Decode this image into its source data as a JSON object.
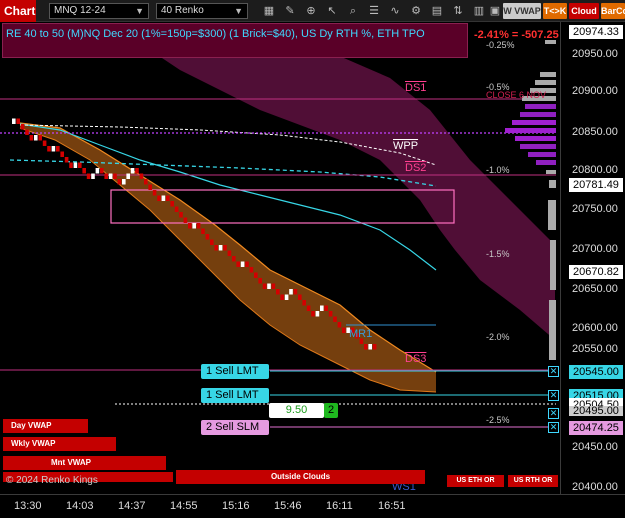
{
  "toolbar": {
    "chart_label": "Chart",
    "instrument": "MNQ 12-24",
    "bar_type": "40 Renko",
    "wvwap_label": "W VWAP",
    "tk_label": "T<>K",
    "cloud_label": "Cloud",
    "barco_label": "BarCo"
  },
  "header": {
    "info": "RE 40 to 50 (M)NQ Dec 20 (1%=150p=$300) (1 Brick=$40), US Dy RTH %, ETH TPO",
    "pct_change": "-2.41% = -507.25"
  },
  "levels": {
    "ds1": "DS1",
    "close6": "CLOSE 6 NOV",
    "wpp": "WPP",
    "ds2": "DS2",
    "mr1": "MR1",
    "ds3": "DS3",
    "ws1": "WS1"
  },
  "percent_labels": [
    "-0.25%",
    "-0.5%",
    "-1.0%",
    "-1.5%",
    "-2.0%",
    "-2.5%"
  ],
  "orders": {
    "sell_lmt_1": "1 Sell LMT",
    "sell_lmt_2": "1 Sell LMT",
    "sell_slm": "2 Sell SLM",
    "pnl_value": "9.50",
    "qty": "2"
  },
  "buttons": {
    "day_vwap": "Day VWAP",
    "wkly_vwap": "Wkly VWAP",
    "mnt_vwap": "Mnt VWAP",
    "outside_clouds": "Outside Clouds",
    "us_eth_or": "US ETH OR",
    "us_rth_or": "US RTH OR"
  },
  "watermark": "© 2024 Renko Kings",
  "price_axis": {
    "ticks": [
      "20950.00",
      "20900.00",
      "20850.00",
      "20800.00",
      "20750.00",
      "20700.00",
      "20650.00",
      "20600.00",
      "20550.00",
      "20450.00",
      "20400.00"
    ],
    "last_top": "20974.33",
    "box_20781": "20781.49",
    "box_20670": "20670.82",
    "box_20545": "20545.00",
    "box_20515": "20515.00",
    "box_20504": "20504.50",
    "box_20495": "20495.00",
    "box_20474": "20474.25"
  },
  "time_axis": [
    "13:30",
    "14:03",
    "14:37",
    "14:55",
    "15:16",
    "15:46",
    "16:11",
    "16:51"
  ],
  "colors": {
    "brick_down": "#d40000",
    "brick_up": "#ffffff",
    "cyan_line": "#37d6e6",
    "orange_band": "#e07a1a",
    "magenta_cloud": "#7a2060",
    "purple_tpo": "#a020d0"
  }
}
